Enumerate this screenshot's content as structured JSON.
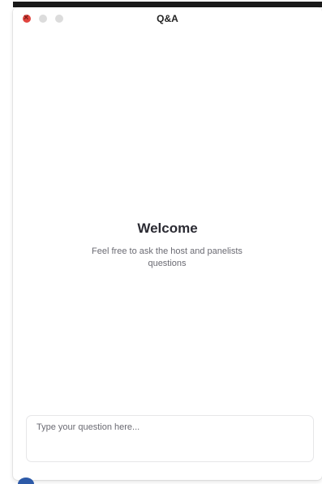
{
  "window": {
    "title": "Q&A"
  },
  "welcome": {
    "heading": "Welcome",
    "message": "Feel free to ask the host and panelists questions"
  },
  "question_input": {
    "placeholder": "Type your question here...",
    "value": ""
  },
  "colors": {
    "close_button": "#e0443e",
    "inactive_button": "#dcdcdc",
    "heading_text": "#2b2b33",
    "body_text": "#6b6b73",
    "dock_icon": "#2d5aa8"
  },
  "icons": {
    "close": "close-icon",
    "minimize": "minimize-icon",
    "zoom": "zoom-icon",
    "dock": "app-dock-icon"
  }
}
